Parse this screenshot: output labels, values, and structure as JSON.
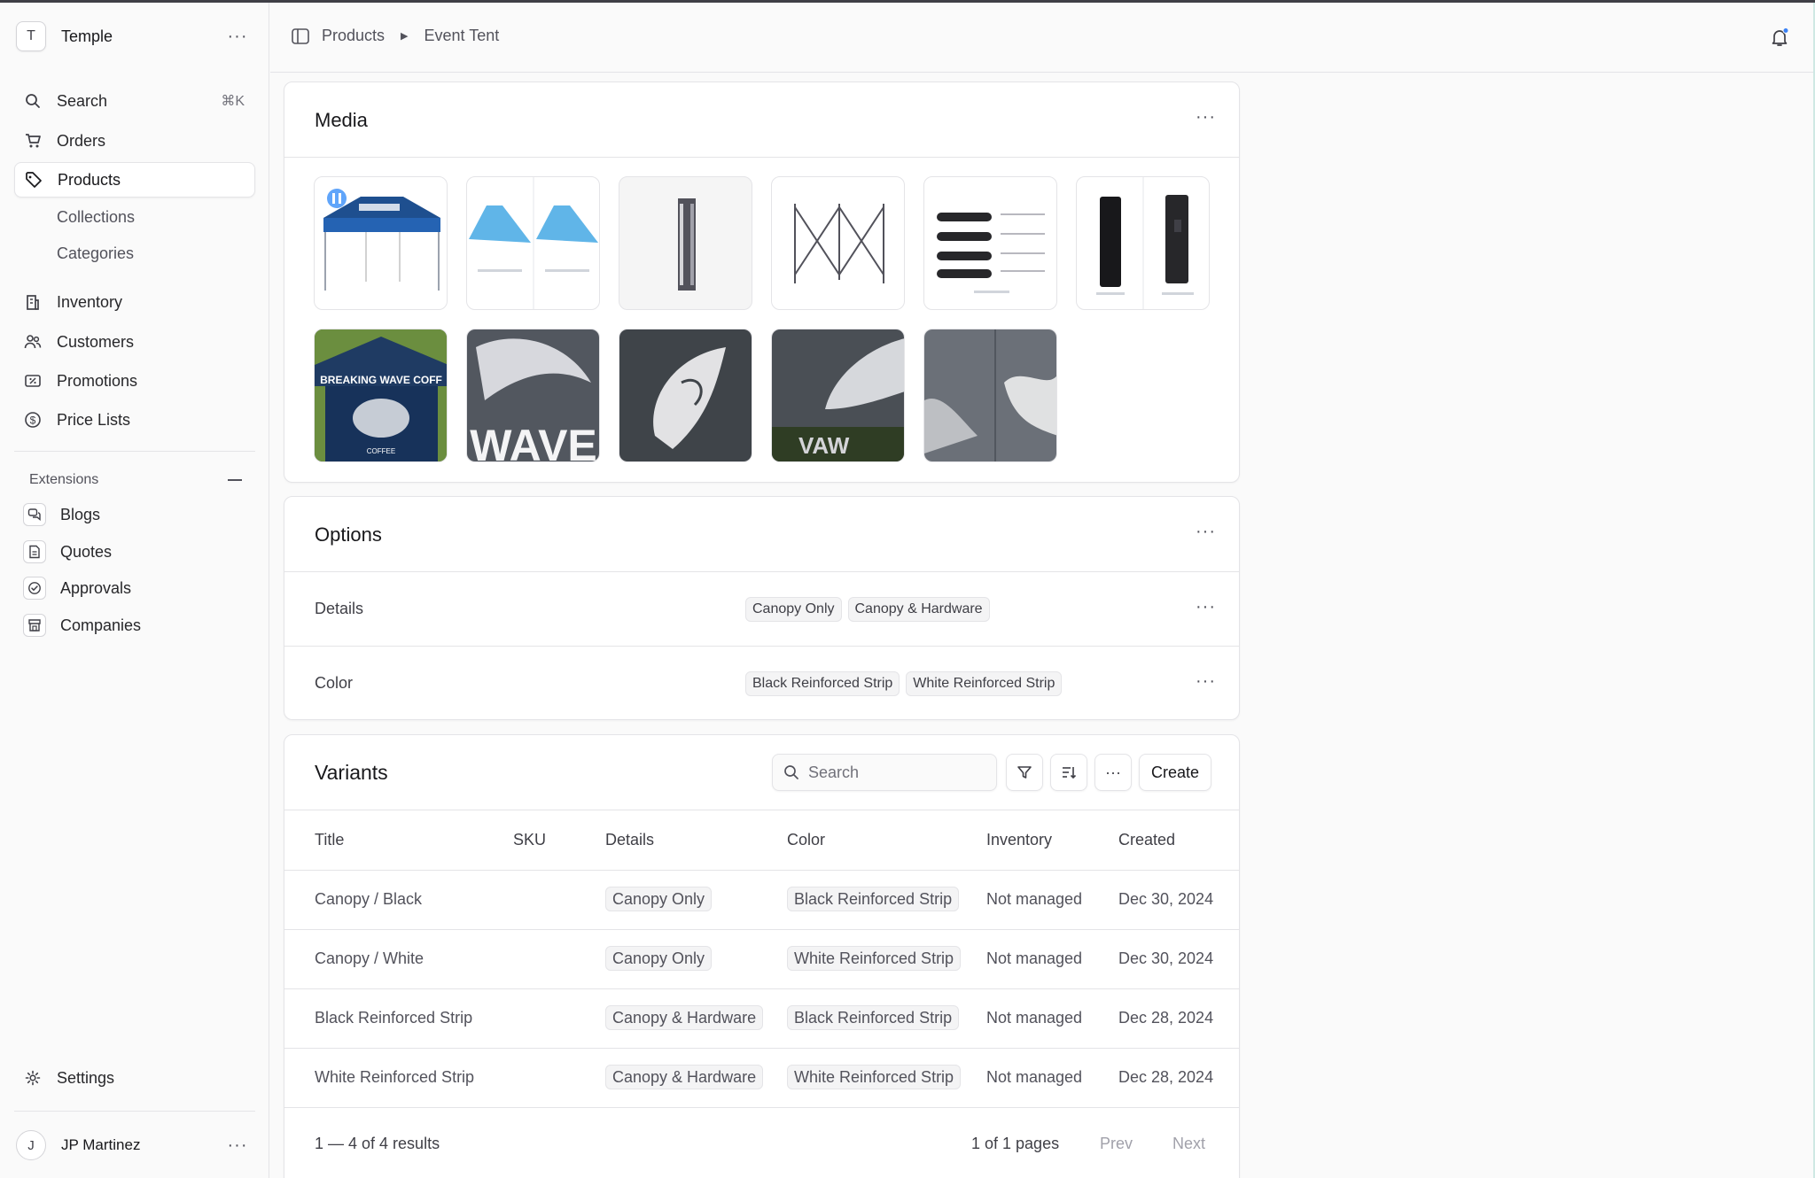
{
  "sidebar": {
    "store_initial": "T",
    "store_name": "Temple",
    "search_label": "Search",
    "search_shortcut": "⌘K",
    "items": {
      "orders": "Orders",
      "products": "Products",
      "collections": "Collections",
      "categories": "Categories",
      "inventory": "Inventory",
      "customers": "Customers",
      "promotions": "Promotions",
      "price_lists": "Price Lists"
    },
    "extensions_label": "Extensions",
    "extensions": {
      "blogs": "Blogs",
      "quotes": "Quotes",
      "approvals": "Approvals",
      "companies": "Companies"
    },
    "settings": "Settings",
    "user_initial": "J",
    "user_name": "JP Martinez"
  },
  "breadcrumb": {
    "products": "Products",
    "current": "Event Tent"
  },
  "media": {
    "title": "Media"
  },
  "options": {
    "title": "Options",
    "rows": [
      {
        "label": "Details",
        "values": [
          "Canopy Only",
          "Canopy & Hardware"
        ]
      },
      {
        "label": "Color",
        "values": [
          "Black Reinforced Strip",
          "White Reinforced Strip"
        ]
      }
    ]
  },
  "variants": {
    "title": "Variants",
    "search_placeholder": "Search",
    "create_label": "Create",
    "columns": [
      "Title",
      "SKU",
      "Details",
      "Color",
      "Inventory",
      "Created"
    ],
    "rows": [
      {
        "title": "Canopy / Black",
        "sku": "",
        "details": "Canopy Only",
        "color": "Black Reinforced Strip",
        "inventory": "Not managed",
        "created": "Dec 30, 2024"
      },
      {
        "title": "Canopy / White",
        "sku": "",
        "details": "Canopy Only",
        "color": "White Reinforced Strip",
        "inventory": "Not managed",
        "created": "Dec 30, 2024"
      },
      {
        "title": "Black Reinforced Strip",
        "sku": "",
        "details": "Canopy & Hardware",
        "color": "Black Reinforced Strip",
        "inventory": "Not managed",
        "created": "Dec 28, 2024"
      },
      {
        "title": "White Reinforced Strip",
        "sku": "",
        "details": "Canopy & Hardware",
        "color": "White Reinforced Strip",
        "inventory": "Not managed",
        "created": "Dec 28, 2024"
      }
    ],
    "pagination": {
      "results": "1 — 4 of 4 results",
      "pages": "1 of 1 pages",
      "prev": "Prev",
      "next": "Next"
    }
  },
  "colors": {
    "accent_dot": "#3b82f6",
    "border": "#e4e4e7",
    "text": "#18181b"
  }
}
